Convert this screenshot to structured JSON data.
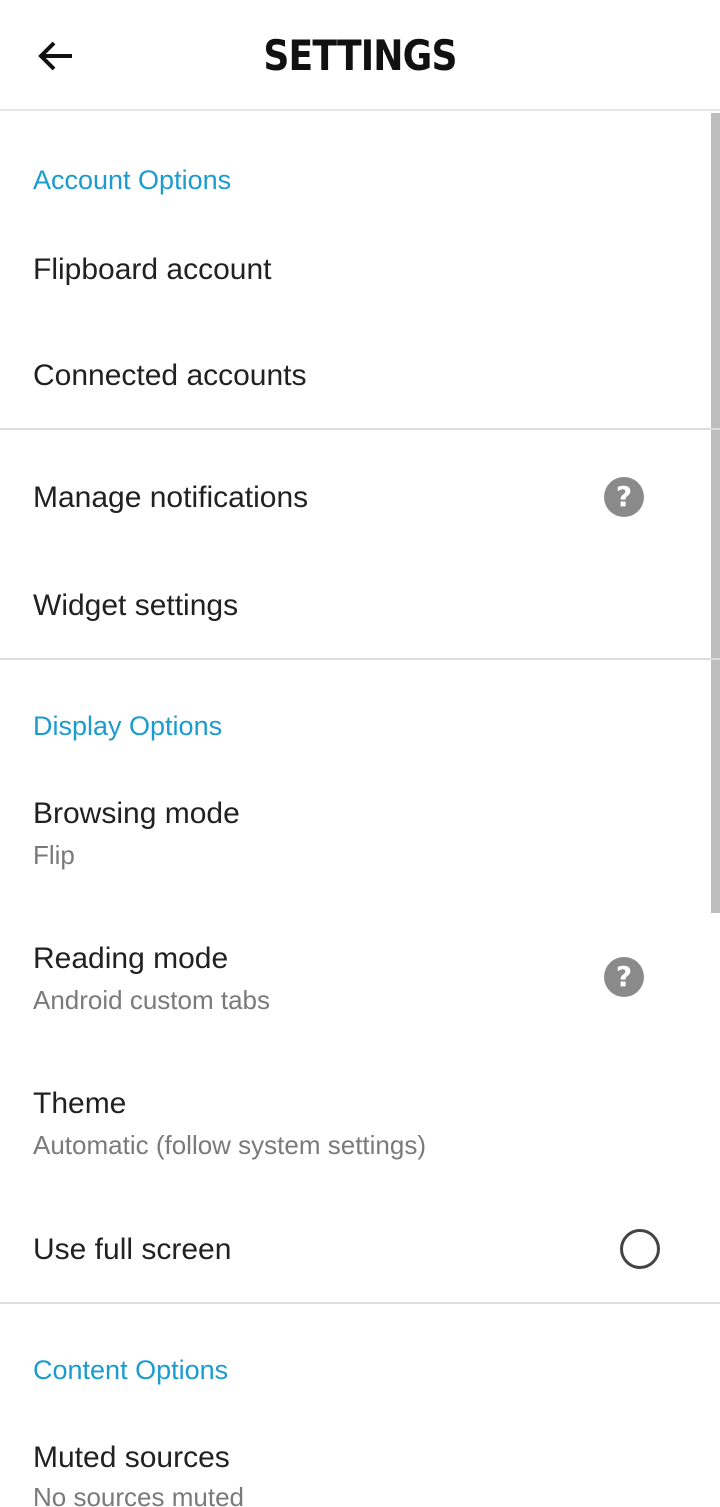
{
  "header": {
    "title": "SETTINGS",
    "back_icon": "arrow-left-icon"
  },
  "sections": {
    "account": {
      "label": "Account Options",
      "items": [
        {
          "title": "Flipboard account"
        },
        {
          "title": "Connected accounts"
        }
      ]
    },
    "notifications": {
      "items": [
        {
          "title": "Manage notifications",
          "icon": "help-icon"
        },
        {
          "title": "Widget settings"
        }
      ]
    },
    "display": {
      "label": "Display Options",
      "items": [
        {
          "title": "Browsing mode",
          "subtitle": "Flip"
        },
        {
          "title": "Reading mode",
          "subtitle": "Android custom tabs",
          "icon": "help-icon"
        },
        {
          "title": "Theme",
          "subtitle": "Automatic (follow system settings)"
        },
        {
          "title": "Use full screen",
          "toggle_checked": false
        }
      ]
    },
    "content": {
      "label": "Content Options",
      "items": [
        {
          "title": "Muted sources",
          "subtitle": "No sources muted"
        }
      ]
    }
  },
  "colors": {
    "accent": "#1a9ccf",
    "text": "#212121",
    "subtext": "#7a7a7a",
    "icon_gray": "#8a8a8a",
    "divider": "#dcdcdc"
  },
  "help_glyph": "?"
}
